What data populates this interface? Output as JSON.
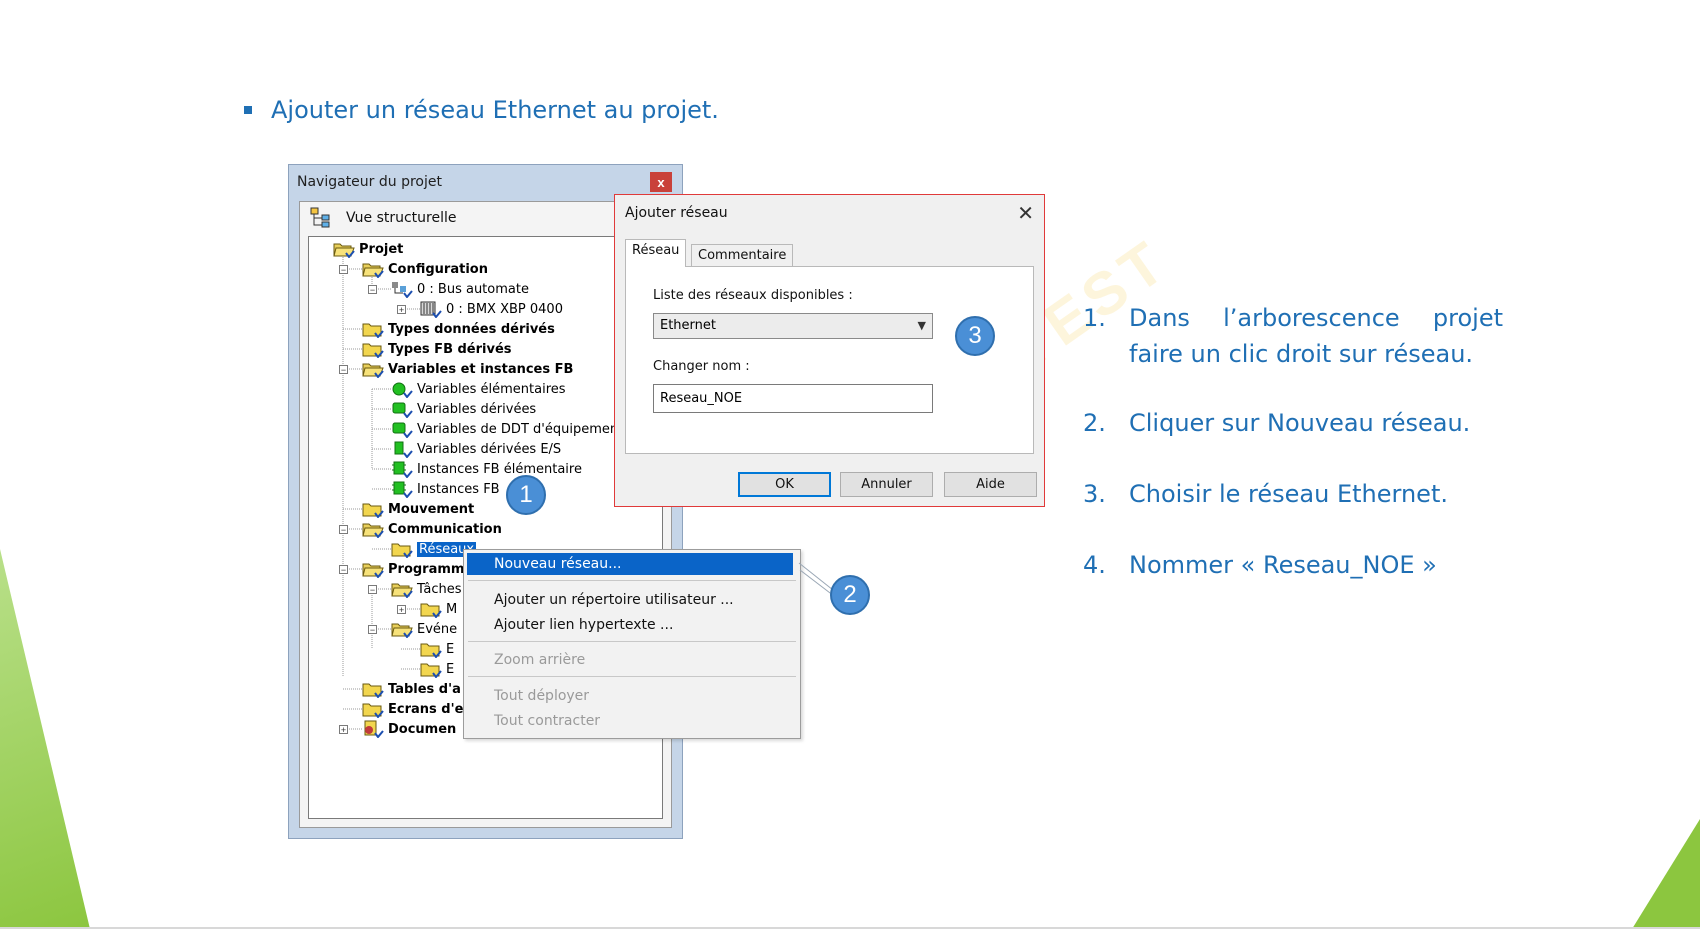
{
  "slide": {
    "title": "Ajouter un réseau Ethernet au projet.",
    "watermark": "TEST",
    "accent_color": "#1f6fb4",
    "green_color": "#8cc63f"
  },
  "navigator": {
    "title": "Navigateur du projet",
    "close_glyph": "x",
    "view_label": "Vue structurelle",
    "tree": [
      {
        "label": "Projet"
      },
      {
        "label": "Configuration"
      },
      {
        "label": "0 : Bus automate"
      },
      {
        "label": "0 : BMX XBP 0400"
      },
      {
        "label": "Types données dérivés"
      },
      {
        "label": "Types FB dérivés"
      },
      {
        "label": "Variables et instances FB"
      },
      {
        "label": "Variables élémentaires"
      },
      {
        "label": "Variables dérivées"
      },
      {
        "label": "Variables de DDT d'équipement"
      },
      {
        "label": "Variables dérivées E/S"
      },
      {
        "label": "Instances FB élémentaire"
      },
      {
        "label": "Instances FB"
      },
      {
        "label": "Mouvement"
      },
      {
        "label": "Communication"
      },
      {
        "label": "Réseaux"
      },
      {
        "label": "Programm"
      },
      {
        "label": "Tâches"
      },
      {
        "label": "M"
      },
      {
        "label": "Evéne"
      },
      {
        "label": "E"
      },
      {
        "label": "E"
      },
      {
        "label": "Tables d'a"
      },
      {
        "label": "Ecrans d'e"
      },
      {
        "label": "Documen"
      }
    ]
  },
  "context_menu": {
    "items": [
      {
        "label": "Nouveau réseau...",
        "state": "highlighted"
      },
      {
        "label": "Ajouter un répertoire utilisateur ...",
        "state": "enabled"
      },
      {
        "label": "Ajouter lien hypertexte ...",
        "state": "enabled"
      },
      {
        "label": "Zoom arrière",
        "state": "disabled"
      },
      {
        "label": "Tout déployer",
        "state": "disabled"
      },
      {
        "label": "Tout contracter",
        "state": "disabled"
      }
    ]
  },
  "dialog": {
    "title": "Ajouter réseau",
    "close_glyph": "✕",
    "tabs": [
      "Réseau",
      "Commentaire"
    ],
    "networks_label": "Liste des réseaux disponibles :",
    "network_selected": "Ethernet",
    "rename_label": "Changer nom :",
    "name_value": "Reseau_NOE",
    "buttons": {
      "ok": "OK",
      "cancel": "Annuler",
      "help": "Aide"
    }
  },
  "callouts": [
    "1",
    "2",
    "3"
  ],
  "steps": [
    {
      "num": "1.",
      "text": "Dans l’arborescence projet faire un clic droit sur réseau."
    },
    {
      "num": "2.",
      "text": "Cliquer sur Nouveau réseau."
    },
    {
      "num": "3.",
      "text": "Choisir le réseau Ethernet."
    },
    {
      "num": "4.",
      "text": "Nommer «  Reseau_NOE »"
    }
  ]
}
